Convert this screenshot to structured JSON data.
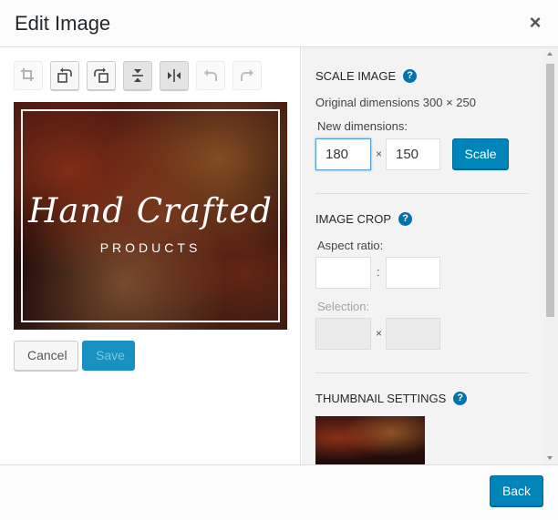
{
  "header": {
    "title": "Edit Image",
    "close_glyph": "×"
  },
  "toolbar": {
    "tools": [
      {
        "name": "crop-icon",
        "enabled": false
      },
      {
        "name": "rotate-left-icon",
        "enabled": true
      },
      {
        "name": "rotate-right-icon",
        "enabled": true
      },
      {
        "name": "flip-vertical-icon",
        "enabled": true
      },
      {
        "name": "flip-horizontal-icon",
        "enabled": true
      },
      {
        "name": "undo-icon",
        "enabled": false
      },
      {
        "name": "redo-icon",
        "enabled": false
      }
    ]
  },
  "preview": {
    "title": "Hand Crafted",
    "subtitle": "PRODUCTS"
  },
  "actions": {
    "cancel_label": "Cancel",
    "save_label": "Save"
  },
  "scale": {
    "heading": "Scale Image",
    "original_text": "Original dimensions 300 × 250",
    "new_label": "New dimensions:",
    "width": "180",
    "height": "150",
    "separator": "×",
    "button_label": "Scale"
  },
  "crop": {
    "heading": "Image Crop",
    "aspect_label": "Aspect ratio:",
    "aspect_separator": ":",
    "aspect_w": "",
    "aspect_h": "",
    "selection_label": "Selection:",
    "selection_separator": "×",
    "selection_w": "",
    "selection_h": ""
  },
  "thumbnail": {
    "heading": "Thumbnail Settings"
  },
  "footer": {
    "back_label": "Back"
  },
  "colors": {
    "primary": "#0085ba",
    "help": "#0073aa"
  }
}
